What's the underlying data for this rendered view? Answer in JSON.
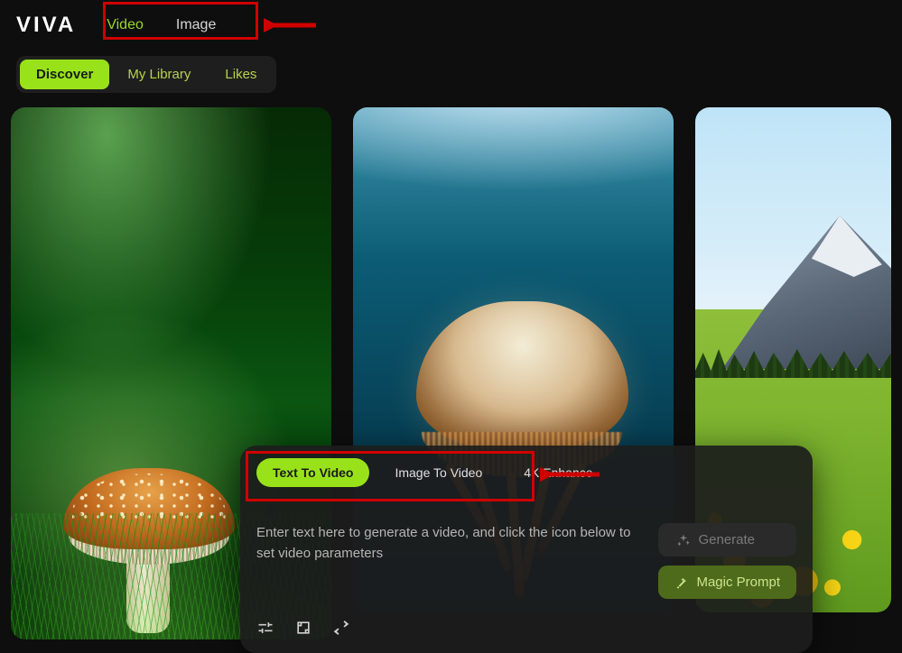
{
  "brand": "VIVA",
  "top_nav": {
    "video": "Video",
    "image": "Image"
  },
  "sub_tabs": {
    "discover": "Discover",
    "library": "My Library",
    "likes": "Likes"
  },
  "prompt": {
    "modes": {
      "text_to_video": "Text To Video",
      "image_to_video": "Image To Video",
      "enhance_4k": "4K Enhance"
    },
    "placeholder": "Enter text here to generate a video, and click the icon below to set video parameters",
    "generate": "Generate",
    "magic": "Magic Prompt"
  },
  "colors": {
    "accent": "#99e21a",
    "annotation": "#d00000"
  }
}
